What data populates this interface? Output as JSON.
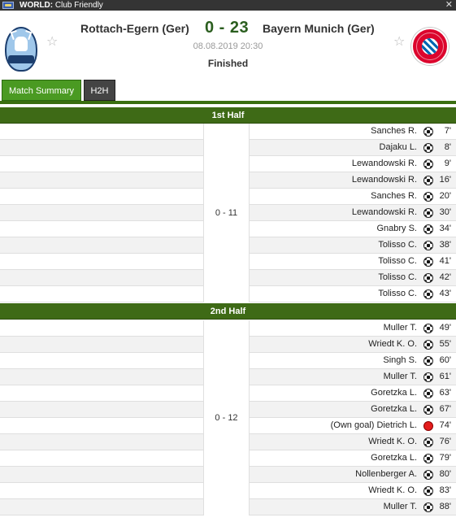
{
  "topbar": {
    "competition_prefix": "WORLD:",
    "competition_name": "Club Friendly"
  },
  "match": {
    "home_team": "Rottach-Egern (Ger)",
    "away_team": "Bayern Munich (Ger)",
    "score": "0 - 23",
    "datetime": "08.08.2019 20:30",
    "status": "Finished"
  },
  "tabs": [
    {
      "label": "Match Summary",
      "active": true
    },
    {
      "label": "H2H",
      "active": false
    }
  ],
  "first_half": {
    "title": "1st Half",
    "score": "0 - 11",
    "events": [
      {
        "player": "Sanches R.",
        "minute": "7'",
        "icon": "goal-ball-icon"
      },
      {
        "player": "Dajaku L.",
        "minute": "8'",
        "icon": "goal-ball-icon"
      },
      {
        "player": "Lewandowski R.",
        "minute": "9'",
        "icon": "goal-ball-icon"
      },
      {
        "player": "Lewandowski R.",
        "minute": "16'",
        "icon": "goal-ball-icon"
      },
      {
        "player": "Sanches R.",
        "minute": "20'",
        "icon": "goal-ball-icon"
      },
      {
        "player": "Lewandowski R.",
        "minute": "30'",
        "icon": "goal-ball-icon"
      },
      {
        "player": "Gnabry S.",
        "minute": "34'",
        "icon": "goal-ball-icon"
      },
      {
        "player": "Tolisso C.",
        "minute": "38'",
        "icon": "goal-ball-icon"
      },
      {
        "player": "Tolisso C.",
        "minute": "41'",
        "icon": "goal-ball-icon"
      },
      {
        "player": "Tolisso C.",
        "minute": "42'",
        "icon": "goal-ball-icon"
      },
      {
        "player": "Tolisso C.",
        "minute": "43'",
        "icon": "goal-ball-icon"
      }
    ]
  },
  "second_half": {
    "title": "2nd Half",
    "score": "0 - 12",
    "events": [
      {
        "player": "Muller T.",
        "minute": "49'",
        "icon": "goal-ball-icon"
      },
      {
        "player": "Wriedt K. O.",
        "minute": "55'",
        "icon": "goal-ball-icon"
      },
      {
        "player": "Singh S.",
        "minute": "60'",
        "icon": "goal-ball-icon"
      },
      {
        "player": "Muller T.",
        "minute": "61'",
        "icon": "goal-ball-icon"
      },
      {
        "player": "Goretzka L.",
        "minute": "63'",
        "icon": "goal-ball-icon"
      },
      {
        "player": "Goretzka L.",
        "minute": "67'",
        "icon": "goal-ball-icon"
      },
      {
        "player": "(Own goal) Dietrich L.",
        "minute": "74'",
        "icon": "own-goal-ball-icon"
      },
      {
        "player": "Wriedt K. O.",
        "minute": "76'",
        "icon": "goal-ball-icon"
      },
      {
        "player": "Goretzka L.",
        "minute": "79'",
        "icon": "goal-ball-icon"
      },
      {
        "player": "Nollenberger A.",
        "minute": "80'",
        "icon": "goal-ball-icon"
      },
      {
        "player": "Wriedt K. O.",
        "minute": "83'",
        "icon": "goal-ball-icon"
      },
      {
        "player": "Muller T.",
        "minute": "88'",
        "icon": "goal-ball-icon"
      }
    ]
  },
  "colors": {
    "header_bar": "#343434",
    "tab_active": "#4a9a22",
    "section_bar": "#3e6a16",
    "score": "#2b5e1f"
  }
}
